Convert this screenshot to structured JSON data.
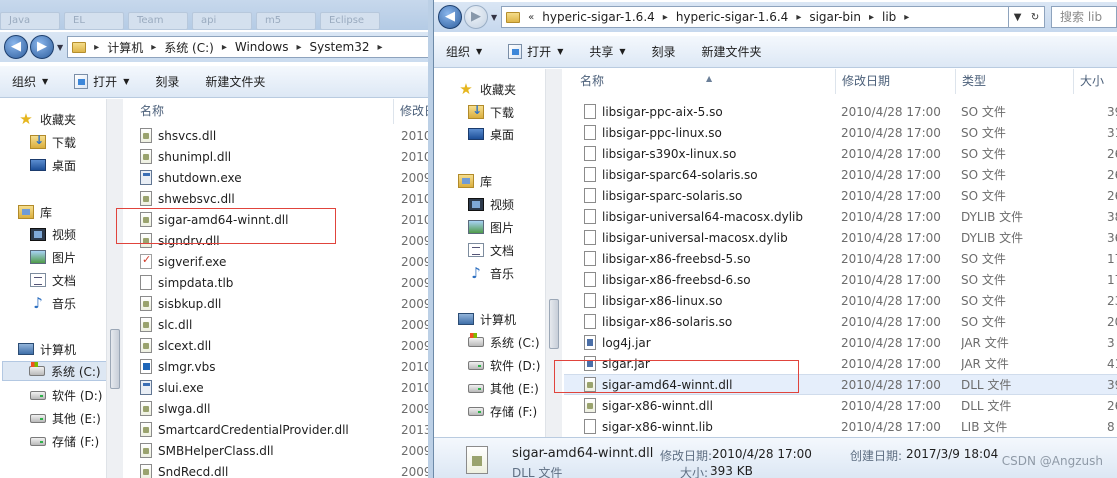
{
  "left": {
    "ghost_tabs": [
      "Java",
      "EL",
      "Team",
      "api",
      "m5",
      "Eclipse"
    ],
    "address": [
      "计算机",
      "系统 (C:)",
      "Windows",
      "System32"
    ],
    "toolbar": [
      "组织",
      "打开",
      "刻录",
      "新建文件夹"
    ],
    "nav": {
      "favorites": "收藏夹",
      "download": "下载",
      "desktop": "桌面",
      "library": "库",
      "video": "视频",
      "pictures": "图片",
      "documents": "文档",
      "music": "音乐",
      "computer": "计算机",
      "drive_c": "系统 (C:)",
      "drive_d": "软件 (D:)",
      "drive_e": "其他 (E:)",
      "drive_f": "存储 (F:)"
    },
    "columns": {
      "name": "名称",
      "modified": "修改日"
    },
    "files": [
      {
        "name": "shsvcs.dll",
        "modified": "2010",
        "icon": "dll"
      },
      {
        "name": "shunimpl.dll",
        "modified": "2010",
        "icon": "dll"
      },
      {
        "name": "shutdown.exe",
        "modified": "2009",
        "icon": "exe"
      },
      {
        "name": "shwebsvc.dll",
        "modified": "2010",
        "icon": "dll"
      },
      {
        "name": "sigar-amd64-winnt.dll",
        "modified": "2010",
        "icon": "dll"
      },
      {
        "name": "signdrv.dll",
        "modified": "2009",
        "icon": "dll"
      },
      {
        "name": "sigverif.exe",
        "modified": "2009",
        "icon": "sig"
      },
      {
        "name": "simpdata.tlb",
        "modified": "2009",
        "icon": "plain"
      },
      {
        "name": "sisbkup.dll",
        "modified": "2009",
        "icon": "dll"
      },
      {
        "name": "slc.dll",
        "modified": "2009",
        "icon": "dll"
      },
      {
        "name": "slcext.dll",
        "modified": "2009",
        "icon": "dll"
      },
      {
        "name": "slmgr.vbs",
        "modified": "2010",
        "icon": "vbs"
      },
      {
        "name": "slui.exe",
        "modified": "2010",
        "icon": "exe"
      },
      {
        "name": "slwga.dll",
        "modified": "2009",
        "icon": "dll"
      },
      {
        "name": "SmartcardCredentialProvider.dll",
        "modified": "2013",
        "icon": "dll"
      },
      {
        "name": "SMBHelperClass.dll",
        "modified": "2009",
        "icon": "dll"
      },
      {
        "name": "SndRecd.dll",
        "modified": "2009",
        "icon": "dll"
      }
    ]
  },
  "right": {
    "address": [
      "hyperic-sigar-1.6.4",
      "hyperic-sigar-1.6.4",
      "sigar-bin",
      "lib"
    ],
    "search_placeholder": "搜索 lib",
    "toolbar": [
      "组织",
      "打开",
      "共享",
      "刻录",
      "新建文件夹"
    ],
    "nav": {
      "favorites": "收藏夹",
      "download": "下载",
      "desktop": "桌面",
      "library": "库",
      "video": "视频",
      "pictures": "图片",
      "documents": "文档",
      "music": "音乐",
      "computer": "计算机",
      "drive_c": "系统 (C:)",
      "drive_d": "软件 (D:)",
      "drive_e": "其他 (E:)",
      "drive_f": "存储 (F:)"
    },
    "columns": {
      "name": "名称",
      "modified": "修改日期",
      "type": "类型",
      "size": "大小"
    },
    "files": [
      {
        "name": "libsigar-ppc-aix-5.so",
        "modified": "2010/4/28 17:00",
        "type": "SO 文件",
        "size": "39",
        "icon": "plain"
      },
      {
        "name": "libsigar-ppc-linux.so",
        "modified": "2010/4/28 17:00",
        "type": "SO 文件",
        "size": "31",
        "icon": "plain"
      },
      {
        "name": "libsigar-s390x-linux.so",
        "modified": "2010/4/28 17:00",
        "type": "SO 文件",
        "size": "26",
        "icon": "plain"
      },
      {
        "name": "libsigar-sparc64-solaris.so",
        "modified": "2010/4/28 17:00",
        "type": "SO 文件",
        "size": "26",
        "icon": "plain"
      },
      {
        "name": "libsigar-sparc-solaris.so",
        "modified": "2010/4/28 17:00",
        "type": "SO 文件",
        "size": "26",
        "icon": "plain"
      },
      {
        "name": "libsigar-universal64-macosx.dylib",
        "modified": "2010/4/28 17:00",
        "type": "DYLIB 文件",
        "size": "38",
        "icon": "plain"
      },
      {
        "name": "libsigar-universal-macosx.dylib",
        "modified": "2010/4/28 17:00",
        "type": "DYLIB 文件",
        "size": "36",
        "icon": "plain"
      },
      {
        "name": "libsigar-x86-freebsd-5.so",
        "modified": "2010/4/28 17:00",
        "type": "SO 文件",
        "size": "17",
        "icon": "plain"
      },
      {
        "name": "libsigar-x86-freebsd-6.so",
        "modified": "2010/4/28 17:00",
        "type": "SO 文件",
        "size": "17",
        "icon": "plain"
      },
      {
        "name": "libsigar-x86-linux.so",
        "modified": "2010/4/28 17:00",
        "type": "SO 文件",
        "size": "23",
        "icon": "plain"
      },
      {
        "name": "libsigar-x86-solaris.so",
        "modified": "2010/4/28 17:00",
        "type": "SO 文件",
        "size": "20",
        "icon": "plain"
      },
      {
        "name": "log4j.jar",
        "modified": "2010/4/28 17:00",
        "type": "JAR 文件",
        "size": "3",
        "icon": "jar"
      },
      {
        "name": "sigar.jar",
        "modified": "2010/4/28 17:00",
        "type": "JAR 文件",
        "size": "41",
        "icon": "jar"
      },
      {
        "name": "sigar-amd64-winnt.dll",
        "modified": "2010/4/28 17:00",
        "type": "DLL 文件",
        "size": "39",
        "icon": "dll"
      },
      {
        "name": "sigar-x86-winnt.dll",
        "modified": "2010/4/28 17:00",
        "type": "DLL 文件",
        "size": "26",
        "icon": "dll"
      },
      {
        "name": "sigar-x86-winnt.lib",
        "modified": "2010/4/28 17:00",
        "type": "LIB 文件",
        "size": "8",
        "icon": "plain"
      }
    ],
    "details": {
      "filename": "sigar-amd64-winnt.dll",
      "modified_label": "修改日期:",
      "modified_value": "2010/4/28 17:00",
      "created_label": "创建日期:",
      "created_value": "2017/3/9 18:04",
      "filetype": "DLL 文件",
      "size_label": "大小:",
      "size_value": "393 KB"
    }
  },
  "watermark": "CSDN @Angzush"
}
